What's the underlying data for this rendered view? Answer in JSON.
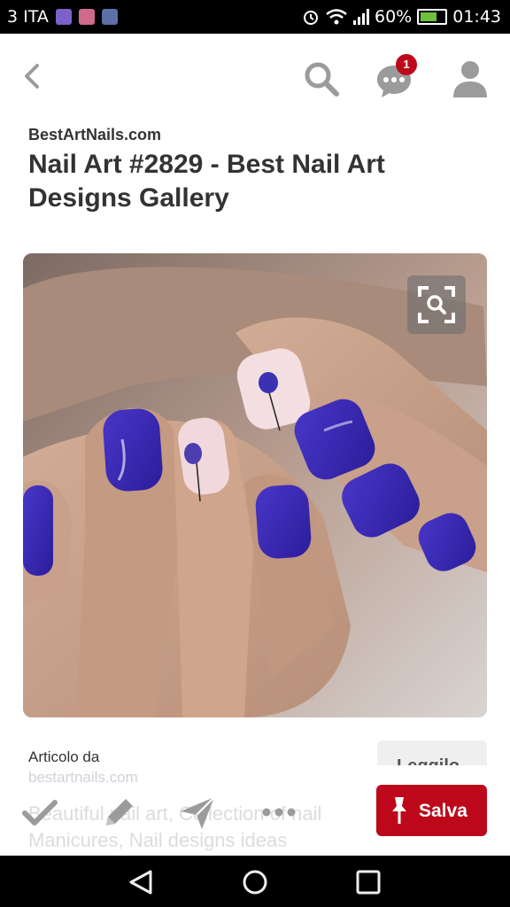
{
  "status_bar": {
    "carrier": "3 ITA",
    "battery": "60%",
    "time": "01:43"
  },
  "top_bar": {
    "notification_count": "1"
  },
  "pin": {
    "source": "BestArtNails.com",
    "title": "Nail Art #2829 - Best Nail Art Designs Gallery",
    "article_from_label": "Articolo da",
    "article_url": "bestartnails.com",
    "read_button_label": "Leggilo",
    "description": "Beautiful nail art, Collection of nail Manicures, Nail designs ideas"
  },
  "actions": {
    "save_label": "Salva"
  },
  "colors": {
    "brand_red": "#bd081c",
    "status_bar_bg": "#000000",
    "text_dark": "#333333",
    "icon_gray": "#9b9b9b"
  },
  "icons": [
    "back-arrow-icon",
    "search-icon",
    "chat-icon",
    "profile-icon",
    "zoom-lens-icon",
    "check-icon",
    "edit-icon",
    "send-icon",
    "more-icon",
    "pin-icon"
  ]
}
